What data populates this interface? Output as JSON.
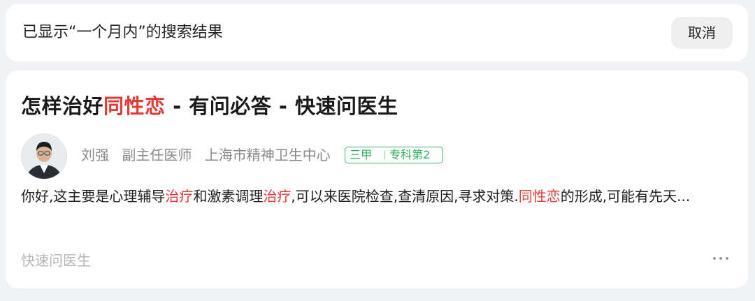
{
  "filter": {
    "text": "已显示“一个月内”的搜索结果",
    "cancel_label": "取消"
  },
  "result": {
    "title_pre": "怎样治好",
    "title_hl": "同性恋",
    "title_post": " - 有问必答 - 快速问医生",
    "author": {
      "name": "刘强",
      "title": "副主任医师",
      "hospital": "上海市精神卫生中心",
      "badge_level": "三甲",
      "badge_rank": "专科第2"
    },
    "snippet": {
      "p1": "你好,这主要是心理辅导",
      "h1": "治疗",
      "p2": "和激素调理",
      "h2": "治疗",
      "p3": ",可以来医院检查,查清原因,寻求对策.",
      "h3": "同性恋",
      "p4": "的形成,可能有先天..."
    },
    "source": "快速问医生"
  },
  "colors": {
    "highlight": "#e53935",
    "badge_green": "#2fae5c",
    "muted": "#8a8a8a"
  },
  "icons": {
    "more": "more-dots-icon"
  }
}
